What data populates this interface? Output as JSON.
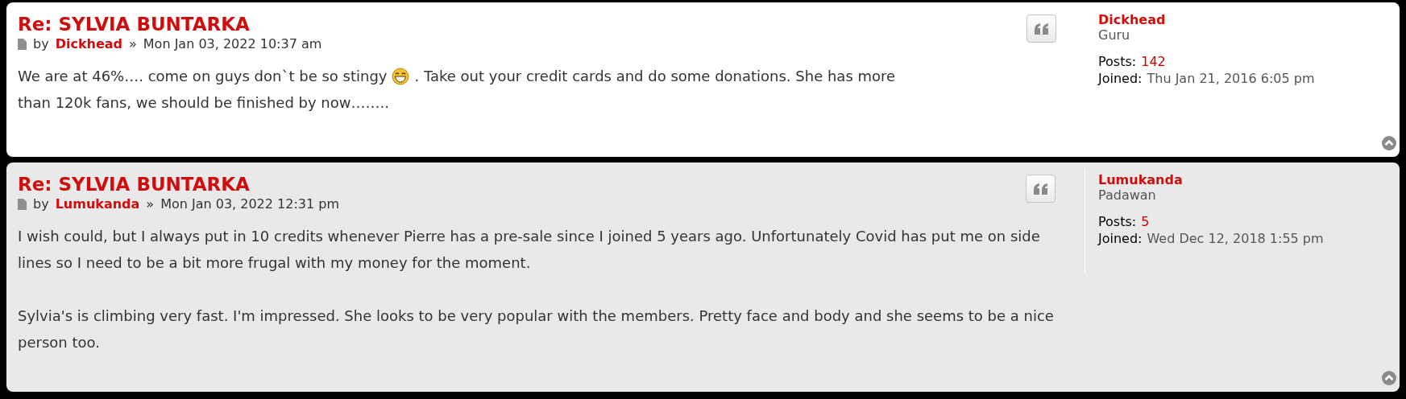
{
  "posts": [
    {
      "title": "Re: SYLVIA BUNTARKA",
      "by": "by",
      "author": "Dickhead",
      "separator": "»",
      "date": "Mon Jan 03, 2022 10:37 am",
      "alt": false,
      "divider": false,
      "paragraphs": [
        {
          "segments": [
            {
              "kind": "text",
              "text": "We are at 46%…. come on guys don`t be so stingy"
            },
            {
              "kind": "smiley"
            },
            {
              "kind": "text",
              "text": ". Take out your credit cards and do some donations. She has more"
            },
            {
              "kind": "text",
              "text": "than 120k fans, we should be finished by now…….."
            }
          ]
        }
      ],
      "profile": {
        "name": "Dickhead",
        "rank": "Guru",
        "posts_label": "Posts:",
        "posts": "142",
        "joined_label": "Joined:",
        "joined": "Thu Jan 21, 2016 6:05 pm"
      }
    },
    {
      "title": "Re: SYLVIA BUNTARKA",
      "by": "by",
      "author": "Lumukanda",
      "separator": "»",
      "date": "Mon Jan 03, 2022 12:31 pm",
      "alt": true,
      "divider": true,
      "paragraphs": [
        {
          "segments": [
            {
              "kind": "text",
              "text": "I wish could, but I always put in 10 credits whenever Pierre has a pre-sale since I joined 5 years ago. Unfortunately Covid has put me on side lines so I need to be a bit more frugal with my money for the moment."
            }
          ]
        },
        {
          "segments": [
            {
              "kind": "text",
              "text": "Sylvia's is climbing very fast. I'm impressed. She looks to be very popular with the members. Pretty face and body and she seems to be a nice person too."
            }
          ]
        }
      ],
      "profile": {
        "name": "Lumukanda",
        "rank": "Padawan",
        "posts_label": "Posts:",
        "posts": "5",
        "joined_label": "Joined:",
        "joined": "Wed Dec 12, 2018 1:55 pm"
      }
    }
  ]
}
